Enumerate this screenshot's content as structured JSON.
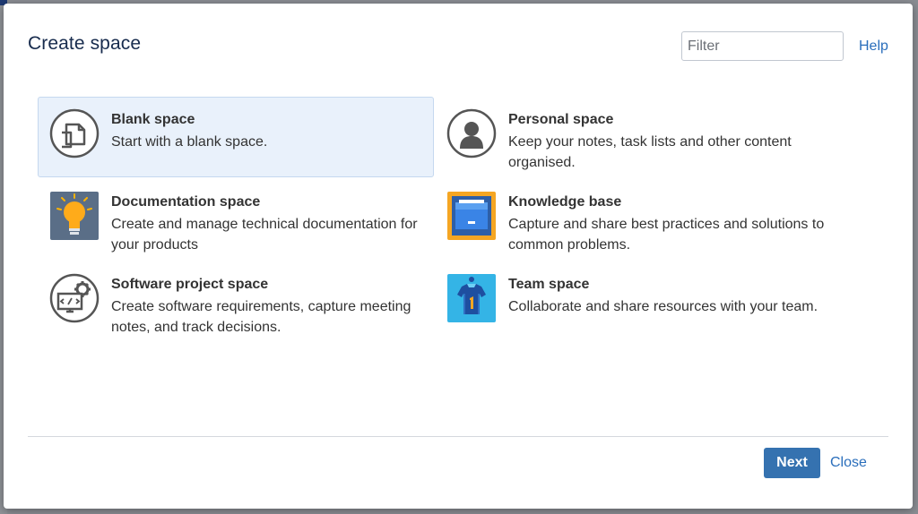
{
  "dialog": {
    "title": "Create space",
    "filter_placeholder": "Filter",
    "help_label": "Help",
    "next_label": "Next",
    "close_label": "Close"
  },
  "spaces": [
    {
      "name": "Blank space",
      "description": "Start with a blank space.",
      "icon": "blank-page-icon",
      "selected": true
    },
    {
      "name": "Personal space",
      "description": "Keep your notes, task lists and other content organised.",
      "icon": "person-icon",
      "selected": false
    },
    {
      "name": "Documentation space",
      "description": "Create and manage technical documentation for your products",
      "icon": "lightbulb-icon",
      "selected": false
    },
    {
      "name": "Knowledge base",
      "description": "Capture and share best practices and solutions to common problems.",
      "icon": "file-cabinet-icon",
      "selected": false
    },
    {
      "name": "Software project space",
      "description": "Create software requirements, capture meeting notes, and track decisions.",
      "icon": "code-gear-icon",
      "selected": false
    },
    {
      "name": "Team space",
      "description": "Collaborate and share resources with your team.",
      "icon": "team-jersey-icon",
      "selected": false
    }
  ],
  "colors": {
    "accent": "#3572b0",
    "link": "#2a6ebb",
    "selected_bg": "#e9f1fb",
    "title": "#172b4d"
  }
}
